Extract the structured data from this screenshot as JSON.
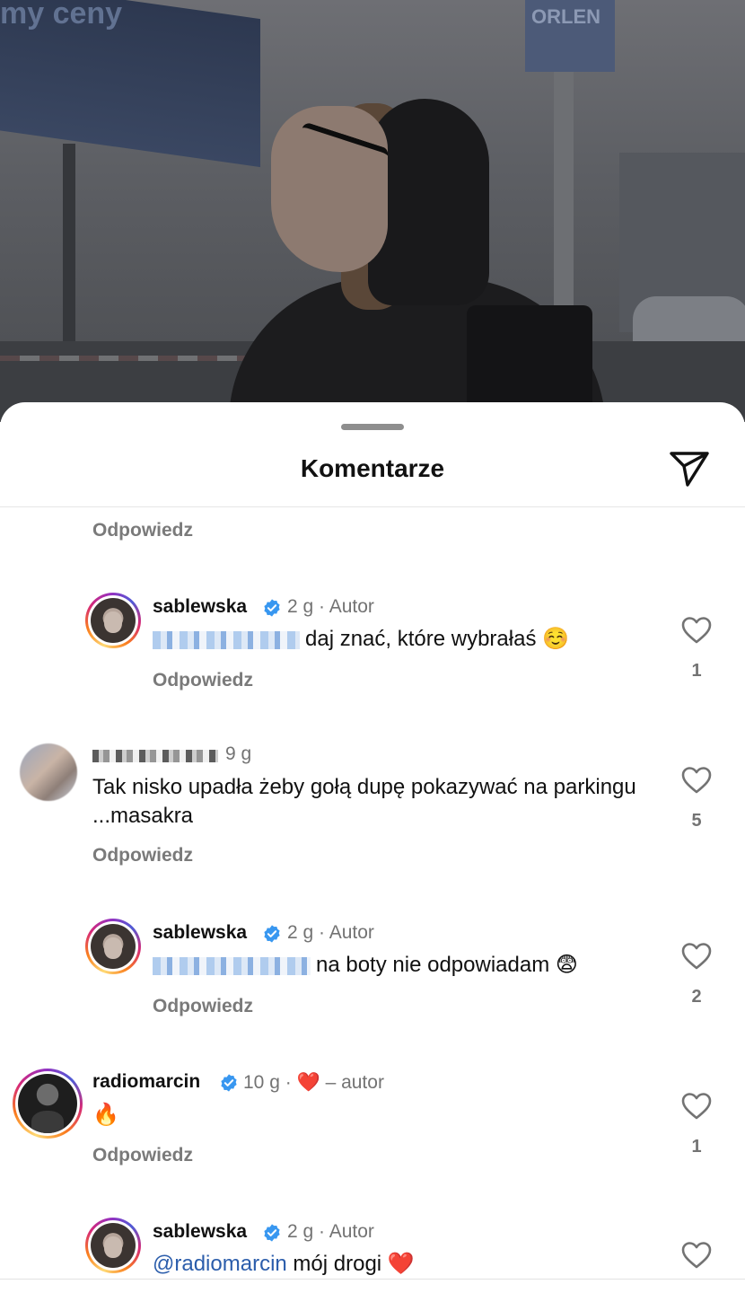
{
  "background": {
    "canopy_text": "my ceny",
    "sign_text": "ORLEN"
  },
  "sheet": {
    "title": "Komentarze"
  },
  "reply_label": "Odpowiedz",
  "comments": [
    {
      "username": "sablewska",
      "verified": true,
      "age": "2 g",
      "badge": "Autor",
      "mention_blurred": true,
      "text": "daj znać, które wybrałaś",
      "emoji": "☺️",
      "likes": "1"
    },
    {
      "username_blurred": true,
      "age": "9 g",
      "text": "Tak nisko upadła żeby  gołą dupę pokazywać na parkingu ...masakra",
      "likes": "5"
    },
    {
      "username": "sablewska",
      "verified": true,
      "age": "2 g",
      "badge": "Autor",
      "mention_blurred": true,
      "text": "na boty nie odpowiadam",
      "emoji": "😨",
      "likes": "2"
    },
    {
      "username": "radiomarcin",
      "verified": true,
      "age": "10 g",
      "heart": "❤️",
      "badge": "– autor",
      "emoji": "🔥",
      "likes": "1"
    },
    {
      "username": "sablewska",
      "verified": true,
      "age": "2 g",
      "badge": "Autor",
      "mention": "@radiomarcin",
      "text": "mój drogi",
      "emoji": "❤️"
    }
  ],
  "dot": "·",
  "colors": {
    "verified_blue": "#3897f0",
    "mention_blue": "#2b5dab",
    "like_grey": "#737373",
    "heart_red": "#e0245e"
  }
}
